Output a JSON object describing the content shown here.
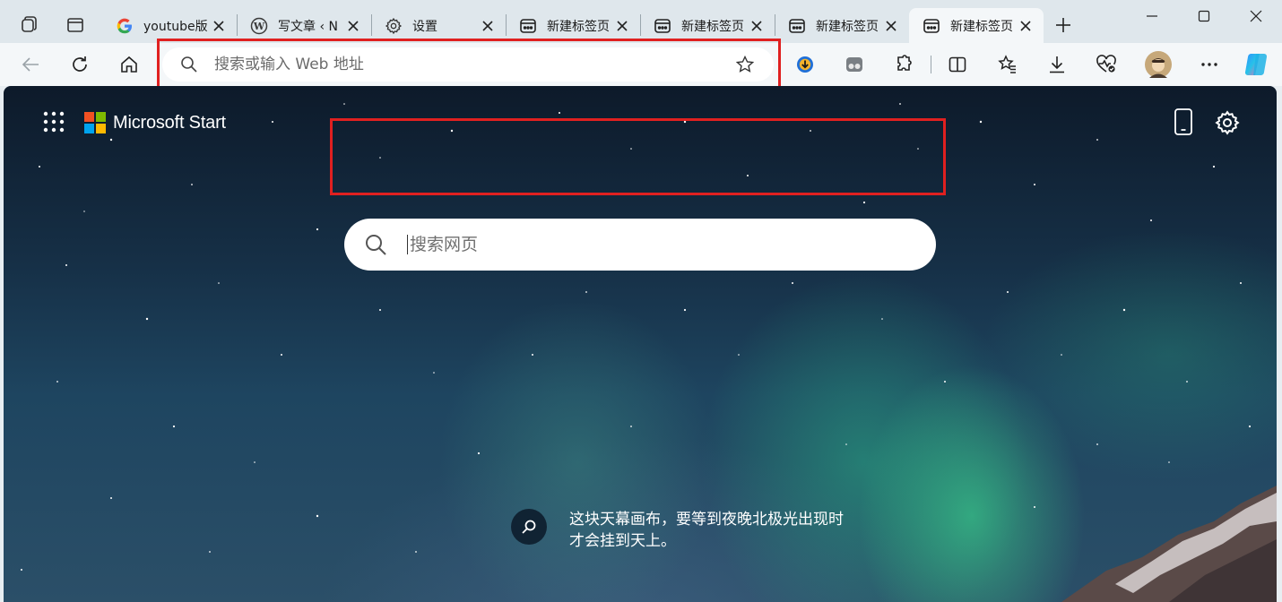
{
  "tabs": [
    {
      "title": "youtube版",
      "icon": "google-icon"
    },
    {
      "title": "写文章 ‹ N",
      "icon": "wordpress-icon"
    },
    {
      "title": "设置",
      "icon": "gear-icon"
    },
    {
      "title": "新建标签页",
      "icon": "newtab-icon"
    },
    {
      "title": "新建标签页",
      "icon": "newtab-icon"
    },
    {
      "title": "新建标签页",
      "icon": "newtab-icon"
    },
    {
      "title": "新建标签页",
      "icon": "newtab-icon",
      "active": true
    }
  ],
  "address_bar": {
    "placeholder": "搜索或输入 Web 地址",
    "value": ""
  },
  "brand": {
    "name": "Microsoft Start",
    "logo_colors": [
      "#f25022",
      "#7fba00",
      "#00a4ef",
      "#ffb900"
    ]
  },
  "search": {
    "placeholder": "搜索网页",
    "value": ""
  },
  "caption": {
    "line1": "这块天幕画布，要等到夜晚北极光出现时",
    "line2": "才会挂到天上。"
  },
  "colors": {
    "highlight_box": "#e02020",
    "tabstrip_bg": "#dfe7ec",
    "toolbar_bg": "#f4f7f9"
  }
}
